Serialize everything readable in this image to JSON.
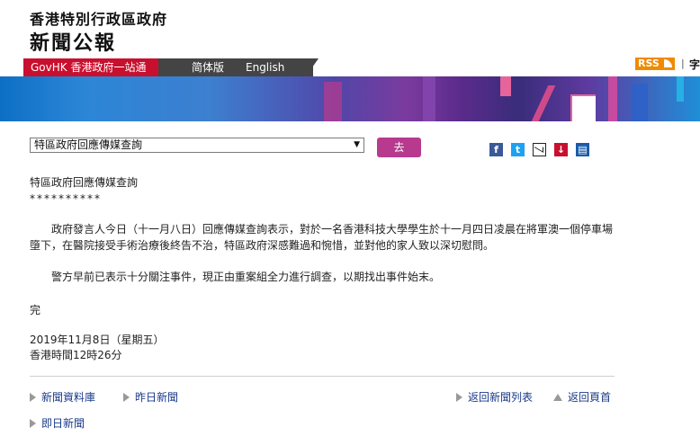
{
  "header": {
    "title_line1": "香港特別行政區政府",
    "title_line2": "新聞公報"
  },
  "nav": {
    "govhk": "GovHK 香港政府一站通",
    "simplified": "简体版",
    "english": "English"
  },
  "tools": {
    "rss": "RSS",
    "font_sep": "|",
    "font_size_char": "字"
  },
  "selector": {
    "selected": "特區政府回應傳媒查詢",
    "arrow": "▼",
    "go_label": "去"
  },
  "share": {
    "facebook": "f",
    "twitter": "t",
    "pdf": "↓",
    "print": "▤"
  },
  "article": {
    "headline": "特區政府回應傳媒查詢",
    "stars": "**********",
    "para1": "政府發言人今日（十一月八日）回應傳媒查詢表示，對於一名香港科技大學學生於十一月四日凌晨在將軍澳一個停車場墮下，在醫院接受手術治療後終告不治，特區政府深感難過和惋惜，並對他的家人致以深切慰問。",
    "para2": "警方早前已表示十分關注事件，現正由重案組全力進行調查，以期找出事件始末。",
    "end": "完",
    "date": "2019年11月8日（星期五）",
    "time": "香港時間12時26分"
  },
  "footer": {
    "news_archive": "新聞資料庫",
    "yesterday": "昨日新聞",
    "back_list": "返回新聞列表",
    "back_top": "返回頁首",
    "today": "即日新聞"
  }
}
